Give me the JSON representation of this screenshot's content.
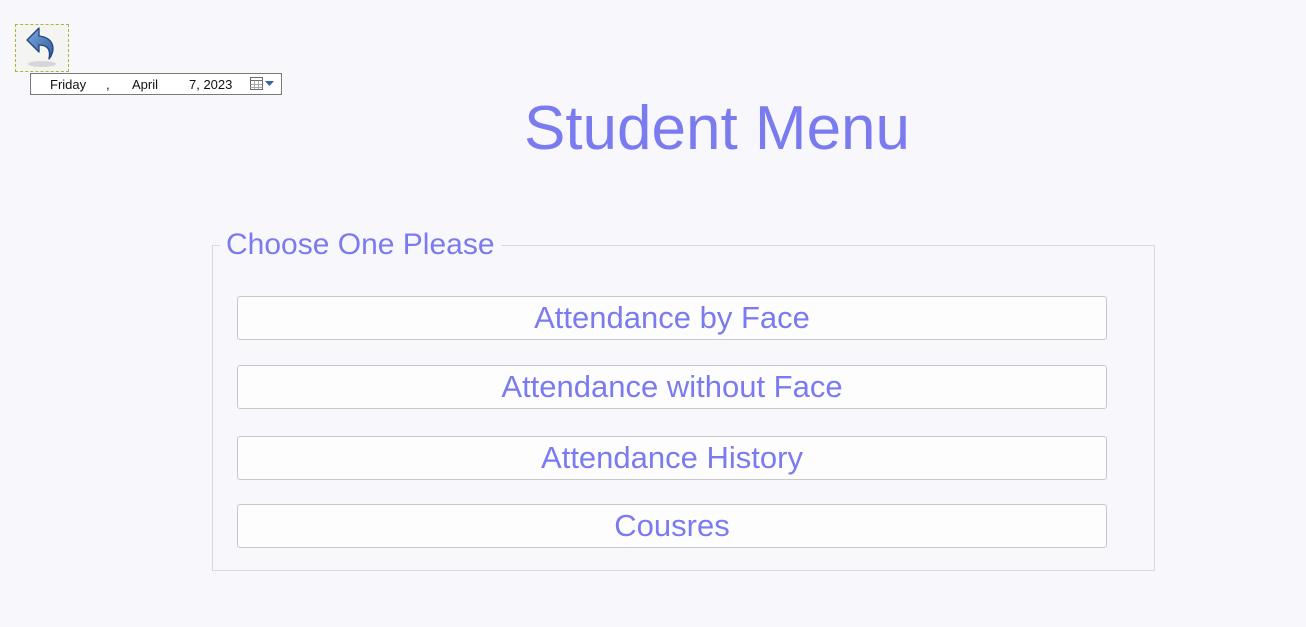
{
  "nav": {
    "back_icon": "undo-arrow-icon"
  },
  "date_picker": {
    "weekday": "Friday",
    "sep": ",",
    "month": "April",
    "day_year": "7, 2023",
    "icon": "calendar-dropdown-icon"
  },
  "page": {
    "title": "Student Menu"
  },
  "menu": {
    "group_label": "Choose One Please",
    "buttons": [
      "Attendance by Face",
      "Attendance without Face",
      "Attendance History",
      "Cousres"
    ]
  },
  "colors": {
    "accent": "#7b7bf0",
    "background": "#f8f8fc"
  }
}
